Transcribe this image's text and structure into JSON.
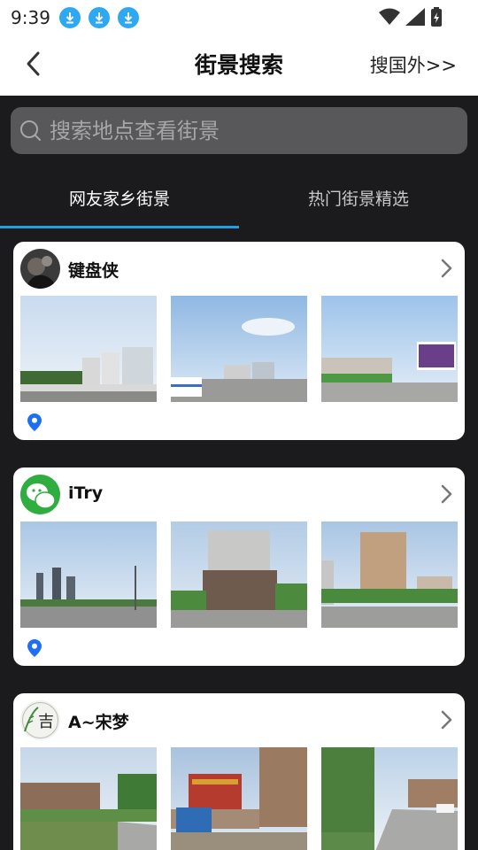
{
  "status_bar": {
    "time": "9:39",
    "download_icons": [
      "download-icon",
      "download-icon",
      "download-icon"
    ]
  },
  "header": {
    "title": "街景搜索",
    "abroad_link": "搜国外>>",
    "back_icon": "chevron-left-icon"
  },
  "search": {
    "placeholder": "搜索地点查看街景"
  },
  "tabs": [
    {
      "label": "网友家乡街景",
      "active": true
    },
    {
      "label": "热门街景精选",
      "active": false
    }
  ],
  "posts": [
    {
      "username": "键盘侠",
      "photos": [
        "street-photo",
        "street-photo",
        "street-photo"
      ],
      "location_icon": "location-pin-icon"
    },
    {
      "username": "iTry",
      "photos": [
        "street-photo",
        "street-photo",
        "street-photo"
      ],
      "location_icon": "location-pin-icon"
    },
    {
      "username": "A~宋梦",
      "photos": [
        "street-photo",
        "street-photo",
        "street-photo"
      ]
    }
  ],
  "colors": {
    "accent": "#1e9fe0",
    "background": "#1b1b1d",
    "search_bg": "#58585a",
    "pin": "#1f6ff2"
  }
}
